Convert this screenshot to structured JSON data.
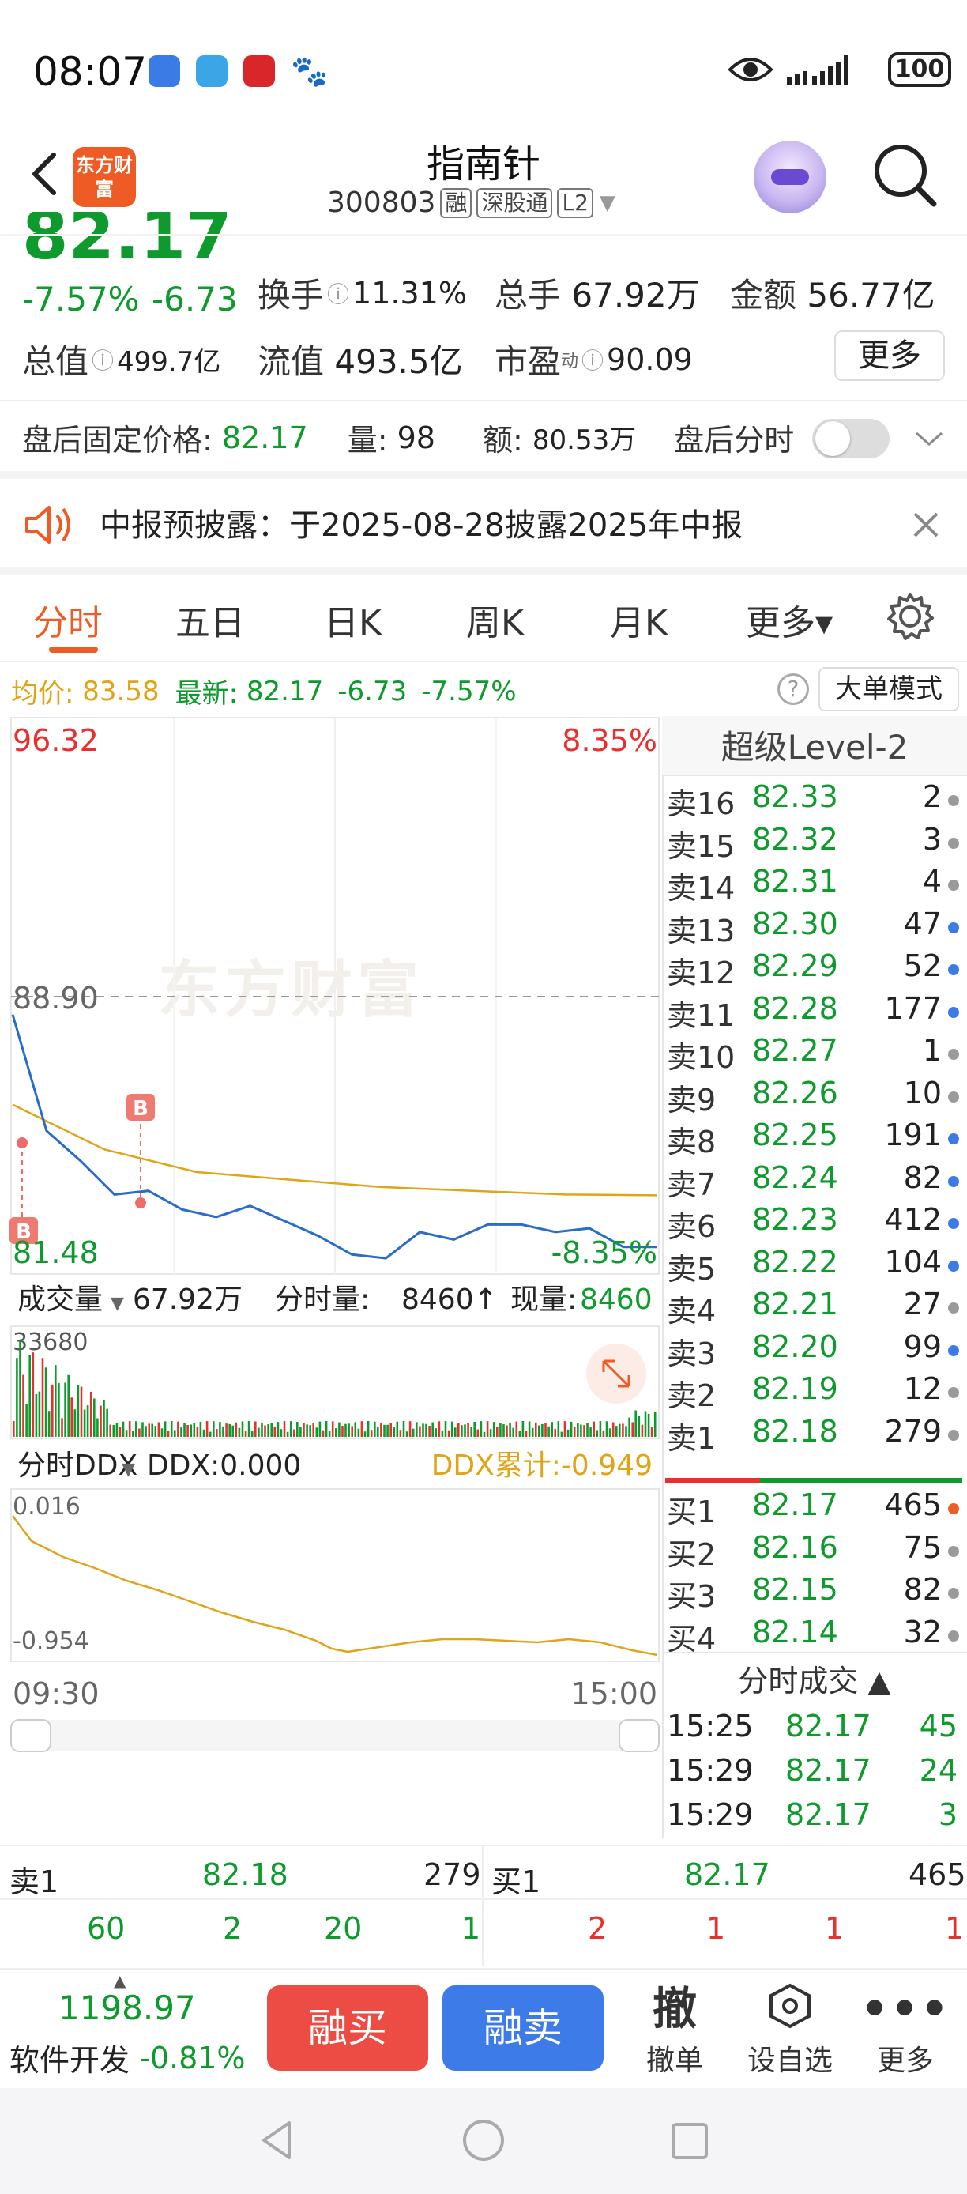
{
  "status_bar": {
    "time": "08:07",
    "battery": "100",
    "icons": [
      "voice-app-icon",
      "message-app-icon",
      "music-app-icon",
      "baidu-app-icon",
      "eye-icon",
      "signal-icon",
      "battery-icon"
    ]
  },
  "header": {
    "logo_text": "东方财富",
    "stock_name": "指南针",
    "stock_code": "300803",
    "tags": [
      "融",
      "深股通",
      "L2"
    ]
  },
  "quote": {
    "price": "82.17",
    "change_pct": "-7.57%",
    "change_amt": "-6.73",
    "turnover_label": "换手",
    "turnover": "11.31%",
    "volume_label": "总手",
    "volume": "67.92万",
    "amount_label": "金额",
    "amount": "56.77亿",
    "mktcap_label": "总值",
    "mktcap": "499.7亿",
    "float_label": "流值",
    "float_val": "493.5亿",
    "pe_label": "市盈",
    "pe_sup": "动",
    "pe": "90.09",
    "more_label": "更多"
  },
  "after_hours": {
    "price_label": "盘后固定价格:",
    "price": "82.17",
    "vol_label": "量:",
    "vol": "98",
    "amt_label": "额:",
    "amt": "80.53万",
    "tick_label": "盘后分时"
  },
  "notice": {
    "text": "中报预披露：于2025-08-28披露2025年中报"
  },
  "tabs": [
    "分时",
    "五日",
    "日K",
    "周K",
    "月K",
    "更多▾"
  ],
  "avg_row": {
    "avg_label": "均价:",
    "avg": "83.58",
    "last_label": "最新:",
    "last": "82.17",
    "chg": "-6.73",
    "pct": "-7.57%",
    "bigorder": "大单模式"
  },
  "chart": {
    "y_high": "96.32",
    "y_mid": "88.90",
    "y_low": "81.48",
    "pct_high": "8.35%",
    "pct_low": "-8.35%",
    "watermark": "东方财富",
    "vol_label": "成交量",
    "vol_total": "67.92万",
    "tick_vol_label": "分时量:",
    "tick_vol": "8460↑",
    "cur_vol_label": "现量:",
    "cur_vol": "8460",
    "vol_max": "33680",
    "ddx_label": "分时DDX",
    "ddx_val": "DDX:0.000",
    "ddx_cum": "DDX累计:-0.949",
    "ddx_top": "0.016",
    "ddx_bottom": "-0.954",
    "time_start": "09:30",
    "time_end": "15:00",
    "marker": "B"
  },
  "chart_data": {
    "type": "line",
    "title": "",
    "xlabel": "",
    "ylabel": "",
    "x": [
      "09:30",
      "15:00"
    ],
    "ylim": [
      81.48,
      96.32
    ],
    "prev_close": 88.9,
    "series": [
      {
        "values": [
          88.4,
          85.3,
          84.5,
          83.6,
          83.7,
          83.2,
          83.0,
          83.3,
          82.9,
          82.5,
          82.0,
          81.9,
          82.6,
          82.4,
          82.8,
          82.8,
          82.6,
          82.7,
          82.2,
          82.2
        ]
      },
      {
        "values": [
          86.0,
          84.8,
          84.2,
          84.0,
          83.8,
          83.7,
          83.6,
          83.58
        ]
      }
    ]
  },
  "orderbook": {
    "title": "超级Level-2",
    "asks": [
      {
        "label": "卖16",
        "price": "82.33",
        "qty": "2",
        "dot": "#9a9a9a"
      },
      {
        "label": "卖15",
        "price": "82.32",
        "qty": "3",
        "dot": "#9a9a9a"
      },
      {
        "label": "卖14",
        "price": "82.31",
        "qty": "4",
        "dot": "#9a9a9a"
      },
      {
        "label": "卖13",
        "price": "82.30",
        "qty": "47",
        "dot": "#3a7be6"
      },
      {
        "label": "卖12",
        "price": "82.29",
        "qty": "52",
        "dot": "#3a7be6"
      },
      {
        "label": "卖11",
        "price": "82.28",
        "qty": "177",
        "dot": "#3a7be6"
      },
      {
        "label": "卖10",
        "price": "82.27",
        "qty": "1",
        "dot": "#9a9a9a"
      },
      {
        "label": "卖9",
        "price": "82.26",
        "qty": "10",
        "dot": "#9a9a9a"
      },
      {
        "label": "卖8",
        "price": "82.25",
        "qty": "191",
        "dot": "#3a7be6"
      },
      {
        "label": "卖7",
        "price": "82.24",
        "qty": "82",
        "dot": "#3a7be6"
      },
      {
        "label": "卖6",
        "price": "82.23",
        "qty": "412",
        "dot": "#3a7be6"
      },
      {
        "label": "卖5",
        "price": "82.22",
        "qty": "104",
        "dot": "#3a7be6"
      },
      {
        "label": "卖4",
        "price": "82.21",
        "qty": "27",
        "dot": "#9a9a9a"
      },
      {
        "label": "卖3",
        "price": "82.20",
        "qty": "99",
        "dot": "#3a7be6"
      },
      {
        "label": "卖2",
        "price": "82.19",
        "qty": "12",
        "dot": "#9a9a9a"
      },
      {
        "label": "卖1",
        "price": "82.18",
        "qty": "279",
        "dot": "#9a9a9a"
      }
    ],
    "bids": [
      {
        "label": "买1",
        "price": "82.17",
        "qty": "465",
        "dot": "#ef5b24"
      },
      {
        "label": "买2",
        "price": "82.16",
        "qty": "75",
        "dot": "#9a9a9a"
      },
      {
        "label": "买3",
        "price": "82.15",
        "qty": "82",
        "dot": "#9a9a9a"
      },
      {
        "label": "买4",
        "price": "82.14",
        "qty": "32",
        "dot": "#9a9a9a"
      }
    ],
    "trades_title": "分时成交 ▲",
    "trades": [
      {
        "time": "15:25",
        "price": "82.17",
        "vol": "45"
      },
      {
        "time": "15:29",
        "price": "82.17",
        "vol": "24"
      },
      {
        "time": "15:29",
        "price": "82.17",
        "vol": "3"
      }
    ]
  },
  "strip": {
    "ask_label": "卖1",
    "ask_price": "82.18",
    "ask_qty": "279",
    "bid_label": "买1",
    "bid_price": "82.17",
    "bid_qty": "465",
    "ask_queue": [
      "60",
      "2",
      "20",
      "1"
    ],
    "bid_queue": [
      "2",
      "1",
      "1",
      "1"
    ]
  },
  "bottom_bar": {
    "index_val": "1198.97",
    "index_name": "软件开发",
    "index_chg": "-0.81%",
    "buy": "融买",
    "sell": "融卖",
    "cancel_icon": "撤",
    "cancel": "撤单",
    "watch": "设自选",
    "more": "更多"
  },
  "colors": {
    "brand": "#ef5b24",
    "down": "#0e9a2c",
    "up": "#e8312f",
    "avg": "#e0a418",
    "price_line": "#2a6cc9",
    "buy_btn": "#ec4c43",
    "sell_btn": "#3d7be8"
  }
}
